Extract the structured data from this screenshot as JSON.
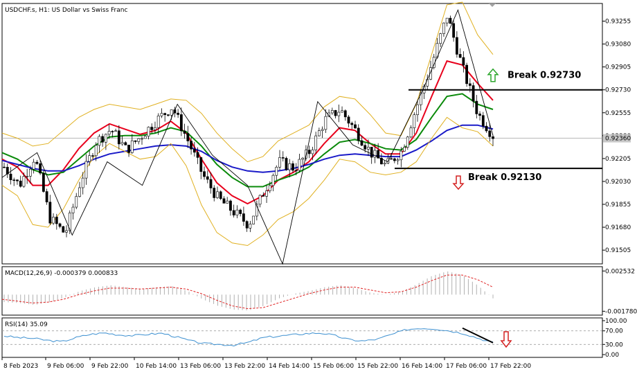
{
  "chart_data": [
    {
      "type": "candlestick",
      "pane": "price",
      "title": "USDCHF.s, H1:  US Dollar vs Swiss Franc",
      "y_ticks": [
        "0.93255",
        "0.93080",
        "0.92905",
        "0.92730",
        "0.92555",
        "0.92380",
        "0.92205",
        "0.92030",
        "0.91855",
        "0.91680",
        "0.91505"
      ],
      "ylim": [
        0.914,
        0.9339
      ],
      "current_price_label": "0.92360",
      "x_ticks": [
        "8 Feb 2023",
        "9 Feb 06:00",
        "9 Feb 22:00",
        "10 Feb 14:00",
        "13 Feb 06:00",
        "13 Feb 22:00",
        "14 Feb 14:00",
        "15 Feb 06:00",
        "15 Feb 22:00",
        "16 Feb 14:00",
        "17 Feb 06:00",
        "17 Feb 22:00"
      ],
      "close_path": [
        0.9214,
        0.92,
        0.9222,
        0.9175,
        0.9163,
        0.9203,
        0.9233,
        0.9243,
        0.9227,
        0.9238,
        0.925,
        0.926,
        0.9235,
        0.9208,
        0.919,
        0.918,
        0.917,
        0.9195,
        0.9218,
        0.9213,
        0.9226,
        0.925,
        0.9258,
        0.9242,
        0.9225,
        0.9215,
        0.9226,
        0.926,
        0.9293,
        0.933,
        0.929,
        0.9255,
        0.9238
      ],
      "series": [
        {
          "name": "",
          "values": [
            0.922,
            0.9214,
            0.92,
            0.92,
            0.9212,
            0.9228,
            0.924,
            0.9247,
            0.9243,
            0.9239,
            0.9242,
            0.9249,
            0.924,
            0.922,
            0.9202,
            0.9192,
            0.9186,
            0.9192,
            0.9204,
            0.921,
            0.9218,
            0.9232,
            0.9244,
            0.9242,
            0.9232,
            0.9224,
            0.9224,
            0.924,
            0.9268,
            0.9295,
            0.9292,
            0.9278,
            0.9265
          ],
          "color": "#e8001c"
        },
        {
          "name": "",
          "values": [
            0.9225,
            0.922,
            0.9212,
            0.9208,
            0.921,
            0.922,
            0.923,
            0.9237,
            0.9238,
            0.9238,
            0.924,
            0.9244,
            0.9241,
            0.923,
            0.9216,
            0.9206,
            0.9199,
            0.9199,
            0.9204,
            0.9208,
            0.9214,
            0.9224,
            0.9233,
            0.9235,
            0.9232,
            0.9228,
            0.9227,
            0.9235,
            0.9252,
            0.9268,
            0.927,
            0.9262,
            0.9258
          ],
          "color": "#0a8a0a"
        },
        {
          "name": "",
          "values": [
            0.9219,
            0.9216,
            0.9213,
            0.9211,
            0.9211,
            0.9215,
            0.922,
            0.9224,
            0.9226,
            0.9228,
            0.923,
            0.9231,
            0.923,
            0.9226,
            0.9219,
            0.9214,
            0.9211,
            0.921,
            0.9211,
            0.9213,
            0.9216,
            0.922,
            0.9223,
            0.9224,
            0.9223,
            0.9222,
            0.9222,
            0.9227,
            0.9234,
            0.9242,
            0.9246,
            0.9246,
            0.9243
          ],
          "color": "#1a1ac8"
        },
        {
          "name": "",
          "values": [
            0.924,
            0.9236,
            0.923,
            0.9232,
            0.9242,
            0.9252,
            0.9258,
            0.9262,
            0.926,
            0.9258,
            0.9262,
            0.9266,
            0.9265,
            0.9255,
            0.924,
            0.9228,
            0.9218,
            0.9222,
            0.9234,
            0.924,
            0.9246,
            0.926,
            0.9268,
            0.9266,
            0.9254,
            0.924,
            0.9238,
            0.9262,
            0.93,
            0.9338,
            0.934,
            0.9315,
            0.93
          ],
          "color": "#e0b020"
        },
        {
          "name": "",
          "values": [
            0.92,
            0.9192,
            0.917,
            0.9168,
            0.9182,
            0.9204,
            0.9222,
            0.9232,
            0.9226,
            0.922,
            0.9222,
            0.9232,
            0.9215,
            0.9185,
            0.9164,
            0.9156,
            0.9154,
            0.9162,
            0.9174,
            0.918,
            0.919,
            0.9204,
            0.922,
            0.9218,
            0.921,
            0.9208,
            0.921,
            0.9218,
            0.9236,
            0.9252,
            0.9244,
            0.9241,
            0.923
          ],
          "color": "#e0b020"
        }
      ],
      "zigzag": [
        0.9206,
        0.9225,
        0.9162,
        0.9218,
        0.92,
        0.9262,
        0.9223,
        0.92,
        0.914,
        0.9264,
        0.9231,
        0.9218,
        0.9273,
        0.9334,
        0.9238
      ],
      "horizontal_levels": [
        {
          "value": 0.9273,
          "label": "Break 0.92730"
        },
        {
          "value": 0.9213,
          "label": "Break 0.92130"
        }
      ],
      "annotations": {
        "up_label": "Break 0.92730",
        "down_label": "Break 0.92130"
      },
      "grid": false
    },
    {
      "type": "histogram",
      "pane": "macd",
      "title": "MACD(12,26,9) -0.000379 0.000833",
      "y_ticks": [
        "0.002532",
        "-0.001780"
      ],
      "ylim": [
        -0.0019,
        0.0027
      ],
      "histogram": [
        -0.0008,
        -0.0009,
        -0.0011,
        -0.0008,
        -0.0003,
        0.0004,
        0.0008,
        0.001,
        0.0008,
        0.0006,
        0.0008,
        0.0009,
        0.0004,
        -0.0005,
        -0.0012,
        -0.0016,
        -0.0017,
        -0.0012,
        -0.0004,
        0.0001,
        0.0004,
        0.0008,
        0.001,
        0.0007,
        0.0002,
        0.0,
        0.0003,
        0.0011,
        0.002,
        0.0025,
        0.0021,
        0.001,
        -0.0004
      ],
      "signal": [
        -0.0005,
        -0.0007,
        -0.0009,
        -0.0008,
        -0.0005,
        0.0,
        0.0004,
        0.0007,
        0.0007,
        0.0006,
        0.0007,
        0.0008,
        0.0006,
        0.0001,
        -0.0006,
        -0.0012,
        -0.0015,
        -0.0014,
        -0.0009,
        -0.0004,
        0.0001,
        0.0005,
        0.0008,
        0.0008,
        0.0005,
        0.0002,
        0.0003,
        0.0008,
        0.0015,
        0.0021,
        0.0021,
        0.0016,
        0.0008
      ]
    },
    {
      "type": "line",
      "pane": "rsi",
      "title": "RSI(14) 35.09",
      "y_ticks": [
        "100.00",
        "70.00",
        "30.00",
        "0.00"
      ],
      "ylim": [
        0,
        100
      ],
      "levels": [
        70,
        30
      ],
      "values": [
        55,
        50,
        48,
        42,
        38,
        50,
        60,
        64,
        58,
        56,
        60,
        63,
        52,
        40,
        32,
        30,
        28,
        36,
        50,
        54,
        58,
        62,
        64,
        56,
        44,
        40,
        46,
        60,
        74,
        78,
        76,
        70,
        62,
        48,
        35
      ]
    }
  ],
  "colors": {
    "up_arrow": "#2aa52a",
    "down_arrow": "#d32020",
    "level_line": "#000000",
    "current_price_line": "#a0a0a0"
  }
}
